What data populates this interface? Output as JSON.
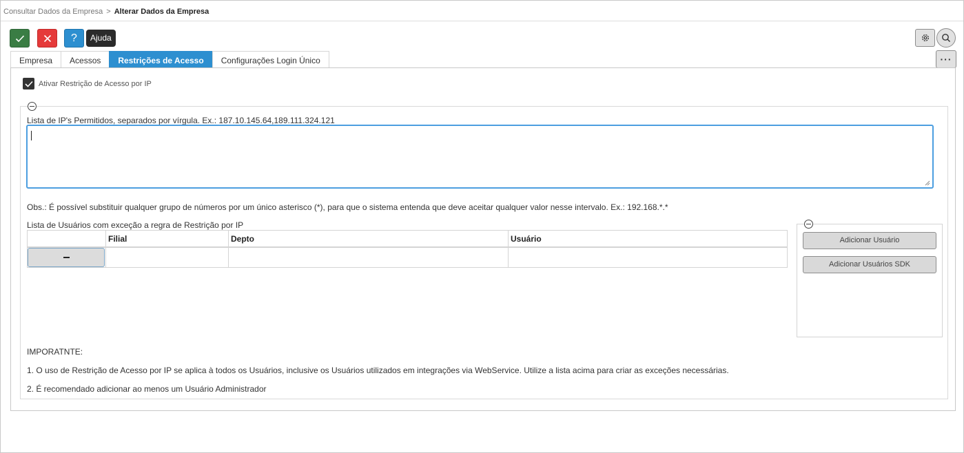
{
  "breadcrumb": {
    "parent": "Consultar Dados da Empresa",
    "separator": ">",
    "current": "Alterar Dados da Empresa"
  },
  "toolbar": {
    "help_glyph": "?",
    "tooltip": "Ajuda",
    "more_glyph": "···",
    "confirm_color": "#3a7d44",
    "cancel_color": "#e53a3a",
    "help_color": "#2d8fd0"
  },
  "tabs": [
    {
      "label": "Empresa"
    },
    {
      "label": "Acessos"
    },
    {
      "label": "Restrições de Acesso",
      "active": true
    },
    {
      "label": "Configurações Login Único"
    }
  ],
  "restriction": {
    "checkbox_label": "Ativar Restrição de Acesso por IP",
    "checked": true
  },
  "ip_list": {
    "label": "Lista de IP's Permitidos, separados por vírgula. Ex.: 187.10.145.64,189.111.324.121",
    "value": ""
  },
  "obs": "Obs.: É possível substituir qualquer grupo de números por um único asterisco (*), para que o sistema entenda que deve aceitar qualquer valor nesse intervalo. Ex.: 192.168.*.*",
  "users": {
    "label": "Lista de Usuários com exceção a regra de Restrição por IP",
    "columns": [
      "Filial",
      "Depto",
      "Usuário"
    ],
    "rows": [
      {
        "filial": "",
        "depto": "",
        "usuario": ""
      }
    ],
    "add_user_button": "Adicionar Usuário",
    "add_sdk_button": "Adicionar Usuários SDK"
  },
  "notes": {
    "title": "IMPORATNTE:",
    "items": [
      "1. O uso de Restrição de Acesso por IP se aplica à todos os Usuários, inclusive os Usuários utilizados em integrações via WebService. Utilize a lista acima para criar as exceções necessárias.",
      "2. É recomendado adicionar ao menos um Usuário Administrador"
    ]
  }
}
